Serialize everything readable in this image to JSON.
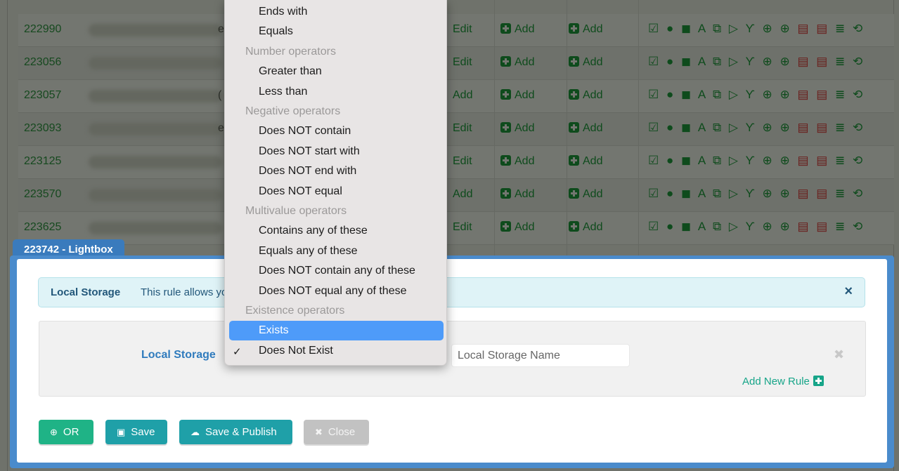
{
  "table": {
    "rows": [
      {
        "id": "222990",
        "tail": "e",
        "action": "Edit"
      },
      {
        "id": "223056",
        "tail": "",
        "action": "Edit"
      },
      {
        "id": "223057",
        "tail": "(",
        "action": "Add"
      },
      {
        "id": "223093",
        "tail": "e",
        "action": "Edit"
      },
      {
        "id": "223125",
        "tail": "",
        "action": "Edit"
      },
      {
        "id": "223570",
        "tail": "",
        "action": "Add"
      },
      {
        "id": "223625",
        "tail": "",
        "action": "Edit"
      }
    ],
    "add_label": "Add",
    "icon_strip": "☑ ● ◼ A ⧉ ▷ Ƴ ⊕ ⊕",
    "icon_strip_red": "▤ ▤",
    "icon_strip_tail": "≣ ⟲"
  },
  "lightbox": {
    "tab_title": "223742 - Lightbox",
    "info_title": "Local Storage",
    "info_text": "This rule allows you t",
    "info_close": "×",
    "rule_label": "Local Storage",
    "rule_placeholder": "Local Storage Name",
    "rule_remove": "✖",
    "add_rule_label": "Add New Rule",
    "buttons": {
      "or": "OR",
      "save": "Save",
      "publish": "Save & Publish",
      "close": "Close"
    }
  },
  "dropdown": {
    "items": [
      {
        "type": "item",
        "label": "Ends with"
      },
      {
        "type": "item",
        "label": "Equals"
      },
      {
        "type": "group",
        "label": "Number operators"
      },
      {
        "type": "item",
        "label": "Greater than"
      },
      {
        "type": "item",
        "label": "Less than"
      },
      {
        "type": "group",
        "label": "Negative operators"
      },
      {
        "type": "item",
        "label": "Does NOT contain"
      },
      {
        "type": "item",
        "label": "Does NOT start with"
      },
      {
        "type": "item",
        "label": "Does NOT end with"
      },
      {
        "type": "item",
        "label": "Does NOT equal"
      },
      {
        "type": "group",
        "label": "Multivalue operators"
      },
      {
        "type": "item",
        "label": "Contains any of these"
      },
      {
        "type": "item",
        "label": "Equals any of these"
      },
      {
        "type": "item",
        "label": "Does NOT contain any of these"
      },
      {
        "type": "item",
        "label": "Does NOT equal any of these"
      },
      {
        "type": "group",
        "label": "Existence operators"
      },
      {
        "type": "highlight",
        "label": "Exists"
      },
      {
        "type": "checked",
        "label": "Does Not Exist"
      }
    ],
    "check_mark": "✓"
  },
  "colors": {
    "accent_blue": "#4a8bcc",
    "green": "#1fb386",
    "teal": "#1fa0a8",
    "highlight": "#4e9bf9"
  }
}
